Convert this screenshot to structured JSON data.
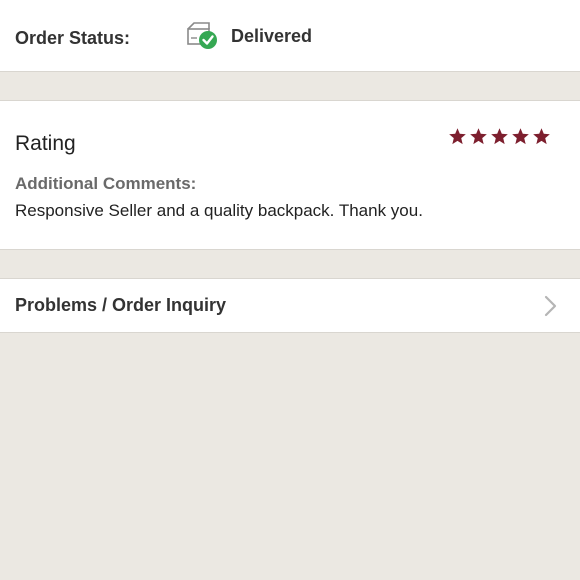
{
  "order_status": {
    "label": "Order Status:",
    "value": "Delivered",
    "icon": "delivered-box-icon",
    "check_color": "#35a853"
  },
  "rating": {
    "label": "Rating",
    "stars_filled": 5,
    "stars_total": 5,
    "star_color": "#7d1f2e",
    "comments_label": "Additional Comments:",
    "comments_text": "Responsive Seller and a quality backpack. Thank you."
  },
  "inquiry": {
    "label": "Problems / Order Inquiry",
    "icon": "chevron-right-icon"
  }
}
